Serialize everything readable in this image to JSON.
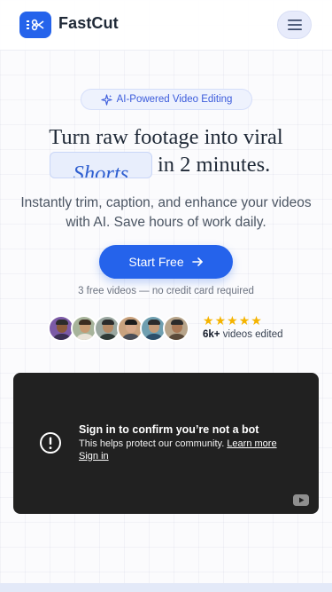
{
  "header": {
    "brand": "FastCut",
    "menu_icon": "hamburger-menu-icon",
    "logo_icon": "scissors-icon"
  },
  "hero": {
    "badge_icon": "sparkle-icon",
    "badge": "AI-Powered Video Editing",
    "headline_line1": "Turn raw footage into viral",
    "headline_highlight": "Shorts",
    "headline_line2_rest": "in 2 minutes.",
    "subtitle": "Instantly trim, caption, and enhance your videos with AI. Save hours of work daily.",
    "cta_label": "Start Free",
    "cta_icon": "arrow-right-icon",
    "cta_note": "3 free videos — no credit card required"
  },
  "social_proof": {
    "avatar_count": 6,
    "stars": 5,
    "count": "6k+",
    "count_label": " videos edited"
  },
  "video_embed": {
    "icon": "alert-circle-icon",
    "title": "Sign in to confirm you’re not a bot",
    "description": "This helps protect our community.",
    "learn_more": "Learn more",
    "sign_in": "Sign in",
    "platform_icon": "youtube-logo-icon"
  },
  "colors": {
    "accent": "#2563eb",
    "badge_bg": "#eef2fd",
    "highlight_text": "#2f5fd0",
    "star": "#f5b400",
    "embed_bg": "#212121"
  }
}
